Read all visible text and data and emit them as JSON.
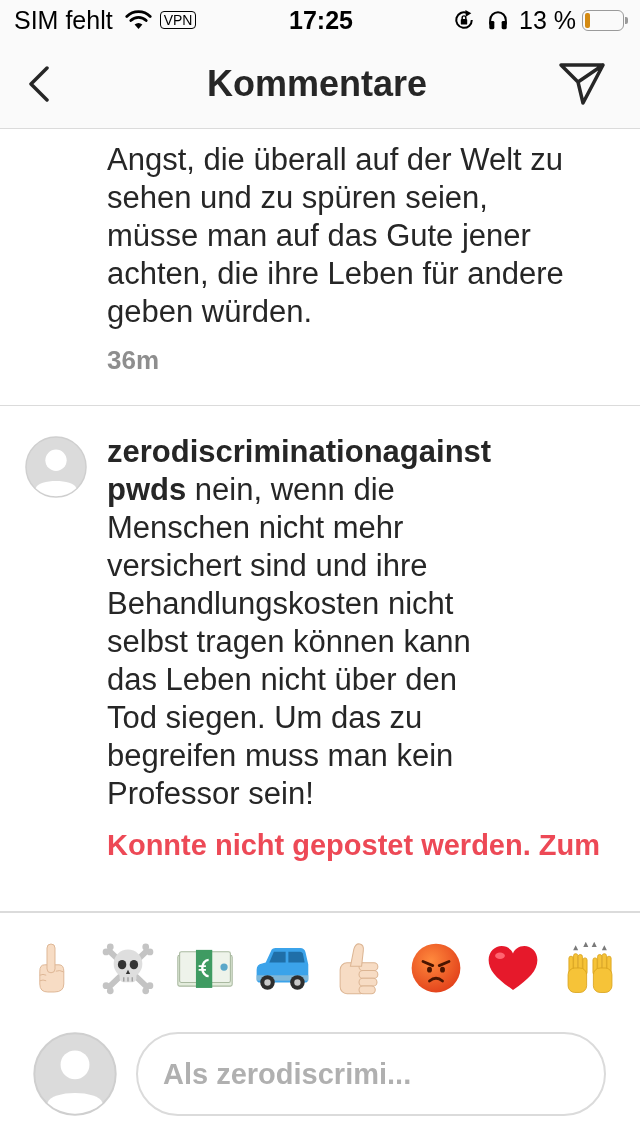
{
  "status_bar": {
    "carrier": "SIM fehlt",
    "vpn": "VPN",
    "time": "17:25",
    "battery": "13 %"
  },
  "header": {
    "title": "Kommentare"
  },
  "comments": [
    {
      "text": "Angst, die überall auf der Welt zu\nsehen und zu spüren seien,\nmüsse man auf das Gute jener\nachten, die ihre Leben für andere\ngeben würden.",
      "time": "36m"
    },
    {
      "username": "zerodiscriminationagainstpwds",
      "text": "nein, wenn die\nMenschen nicht mehr\nversichert sind und ihre\nBehandlungskosten nicht\nselbst tragen können kann\ndas Leben nicht über den\nTod siegen. Um das zu\nbegreifen muss man kein\nProfessor sein!",
      "error": "Konnte nicht gepostet werden. Zum"
    }
  ],
  "composer": {
    "placeholder": "Als zerodiscrimi..."
  }
}
